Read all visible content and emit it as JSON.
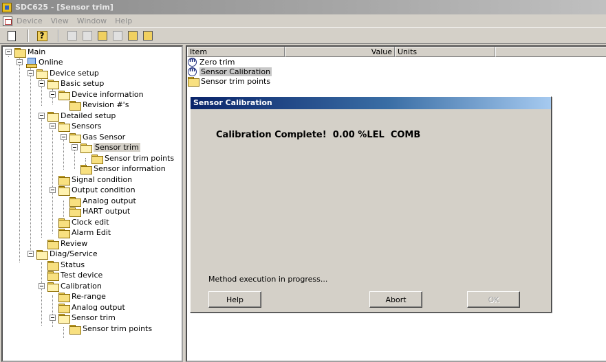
{
  "window": {
    "title": "SDC625 - [Sensor trim]"
  },
  "menu": [
    "Device",
    "View",
    "Window",
    "Help"
  ],
  "tree": {
    "main": "Main",
    "online": "Online",
    "device_setup": "Device setup",
    "basic_setup": "Basic setup",
    "device_information": "Device information",
    "revision": "Revision #'s",
    "detailed_setup": "Detailed setup",
    "sensors": "Sensors",
    "gas_sensor": "Gas Sensor",
    "sensor_trim": "Sensor trim",
    "sensor_trim_points": "Sensor trim points",
    "sensor_information": "Sensor information",
    "signal_condition": "Signal condition",
    "output_condition": "Output condition",
    "analog_output": "Analog output",
    "hart_output": "HART output",
    "clock_edit": "Clock edit",
    "alarm_edit": "Alarm Edit",
    "review": "Review",
    "diag_service": "Diag/Service",
    "status": "Status",
    "test_device": "Test device",
    "calibration": "Calibration",
    "re_range": "Re-range",
    "diag_analog_output": "Analog output",
    "diag_sensor_trim": "Sensor trim",
    "diag_sensor_trim_points": "Sensor trim points"
  },
  "list": {
    "headers": [
      "Item",
      "Value",
      "Units"
    ],
    "rows": [
      "Zero trim",
      "Sensor Calibration",
      "Sensor trim points"
    ]
  },
  "dialog": {
    "title": "Sensor Calibration",
    "message": "Calibration Complete!  0.00 %LEL  COMB",
    "status": "Method execution in progress...",
    "help_label": "Help",
    "abort_label": "Abort",
    "ok_label": "OK"
  }
}
